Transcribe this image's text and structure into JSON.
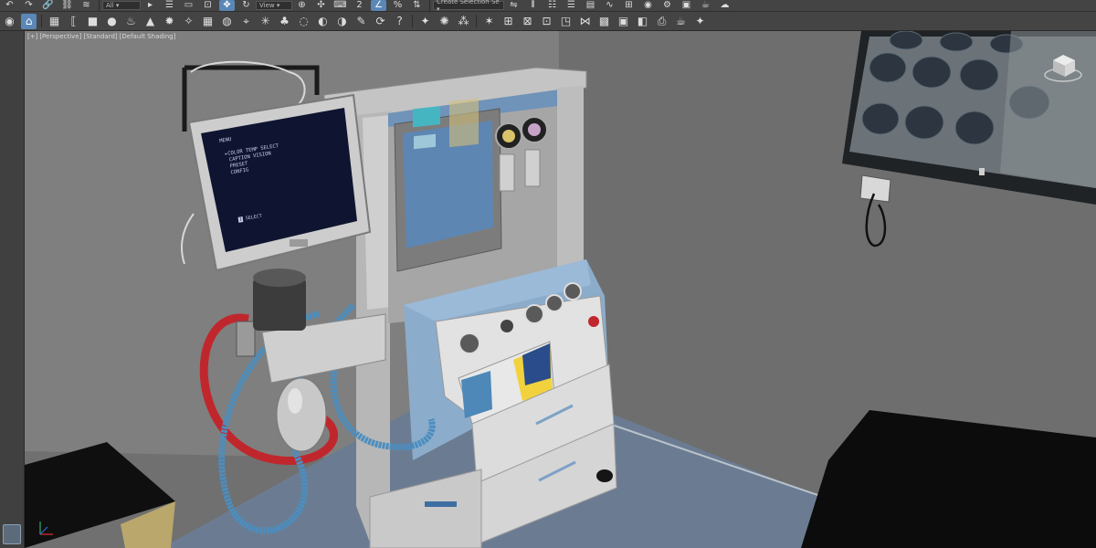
{
  "toolbar_main": {
    "icons": [
      "undo-icon",
      "redo-icon",
      "link-icon",
      "unlink-icon",
      "bind-spacewarp-icon"
    ],
    "selection_filter": "All",
    "icons_b": [
      "select-object-icon",
      "select-by-name-icon",
      "rect-selection-icon",
      "window-crossing-icon",
      "select-move-icon",
      "select-rotate-icon"
    ],
    "ref_coord_system": "View",
    "icons_c": [
      "use-pivot-center-icon",
      "select-manipulate-icon",
      "keyboard-shortcut-icon",
      "snap-toggle-icon",
      "angle-snap-icon",
      "percent-snap-icon",
      "spinner-snap-icon"
    ],
    "selection_set": "Create Selection Se",
    "icons_d": [
      "mirror-icon",
      "align-icon",
      "toggle-scene-explorer-icon",
      "toggle-layer-explorer-icon",
      "toggle-ribbon-icon",
      "curve-editor-icon",
      "schematic-view-icon",
      "material-editor-icon",
      "render-setup-icon",
      "rendered-frame-window-icon",
      "render-production-icon",
      "render-online-icon"
    ]
  },
  "toolbar_secondary": {
    "icons": [
      "viewport-eye-icon",
      "home-grid-icon",
      "layer-manager-icon",
      "brackets-icon",
      "box-icon",
      "sphere-icon",
      "teapot-icon",
      "cone-icon",
      "sun-light-icon",
      "spot-light-icon",
      "grid-icon",
      "geosphere-icon",
      "helper-icon",
      "particle-icon",
      "plant-icon",
      "globe-icon",
      "material-icon",
      "material-map-icon",
      "object-paint-icon",
      "scene-states-icon",
      "help-icon",
      "light-bulb-icon",
      "sky-icon",
      "spray-icon",
      "fire-icon",
      "quad-menu-icon",
      "morph-icon",
      "camera-icon",
      "dummy-icon",
      "flow-icon",
      "stamp-icon",
      "camera-2-icon",
      "tape-icon",
      "print-icon",
      "teapot-2-icon",
      "bulb-2-icon"
    ]
  },
  "viewport": {
    "label_parts": [
      "[+]",
      "[Perspective]",
      "[Standard]",
      "[Default Shading]"
    ]
  },
  "scene": {
    "monitor_menu": {
      "title": "MENU",
      "items": [
        "COLOR TEMP SELECT",
        "CAPTION VISION",
        "PRESET",
        "CONFIG"
      ],
      "footer": "SELECT"
    }
  },
  "colors": {
    "ui_bg": "#444444",
    "active_icon": "#5a87b6",
    "wall": "#7c7c7c",
    "machine_blue": "#6f93b9",
    "floor": "#6d7e93",
    "circuit_red": "#c0272d",
    "circuit_blue": "#4a8ec0"
  }
}
